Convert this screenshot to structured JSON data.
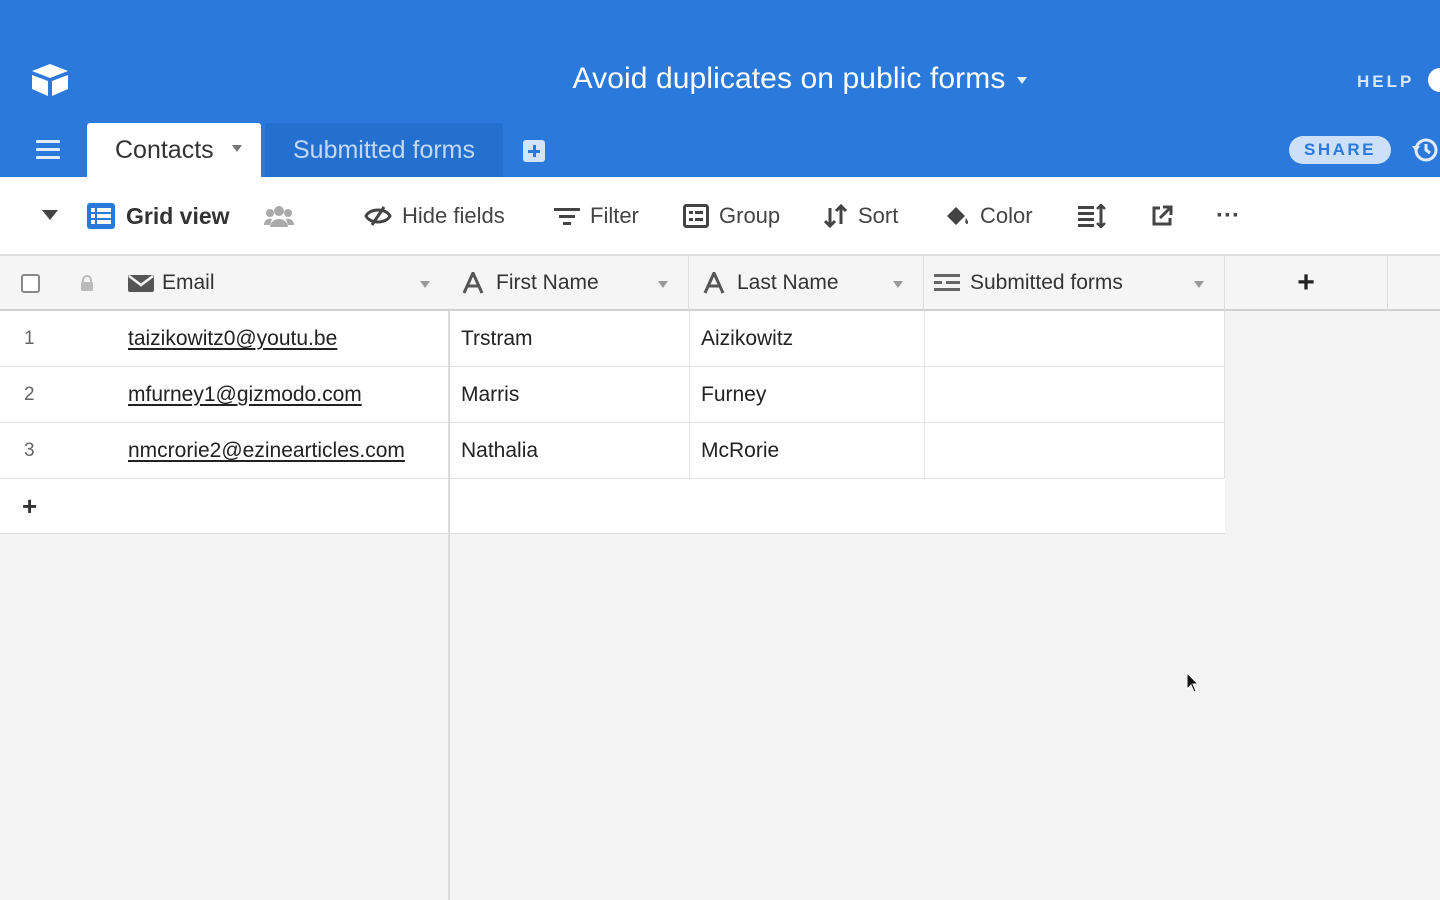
{
  "header": {
    "base_title": "Avoid duplicates on public forms",
    "help_label": "HELP",
    "share_label": "SHARE",
    "brand_color": "#2a79db"
  },
  "tabs": [
    {
      "label": "Contacts",
      "active": true
    },
    {
      "label": "Submitted forms",
      "active": false
    }
  ],
  "toolbar": {
    "view_name": "Grid view",
    "hide_fields": "Hide fields",
    "filter": "Filter",
    "group": "Group",
    "sort": "Sort",
    "color": "Color",
    "more": "···"
  },
  "grid": {
    "columns": [
      {
        "name": "Email",
        "type": "email"
      },
      {
        "name": "First Name",
        "type": "text"
      },
      {
        "name": "Last Name",
        "type": "text"
      },
      {
        "name": "Submitted forms",
        "type": "link"
      }
    ],
    "add_column_label": "+",
    "add_row_label": "+",
    "rows": [
      {
        "num": "1",
        "email": "taizikowitz0@youtu.be",
        "first": "Trstram",
        "last": "Aizikowitz",
        "submitted": ""
      },
      {
        "num": "2",
        "email": "mfurney1@gizmodo.com",
        "first": "Marris",
        "last": "Furney",
        "submitted": ""
      },
      {
        "num": "3",
        "email": "nmcrorie2@ezinearticles.com",
        "first": "Nathalia",
        "last": "McRorie",
        "submitted": ""
      }
    ]
  }
}
